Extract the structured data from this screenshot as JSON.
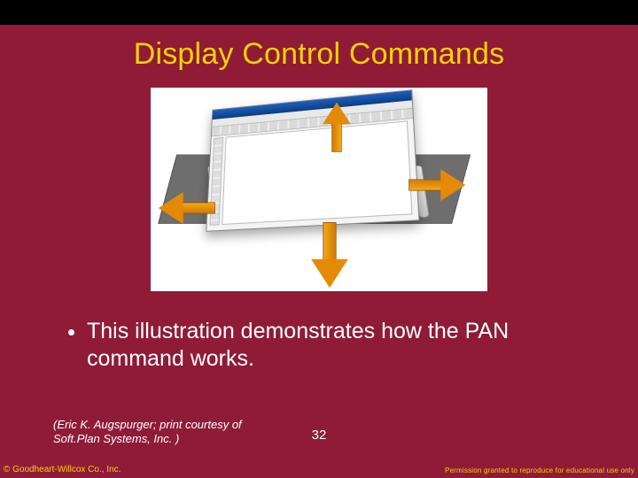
{
  "title": "Display Control Commands",
  "bullet_text": "This illustration demonstrates how the PAN command works.",
  "attribution": "(Eric K. Augspurger; print courtesy of Soft.Plan Systems, Inc. )",
  "slide_number": "32",
  "copyright": "© Goodheart-Willcox Co., Inc.",
  "permission": "Permission granted to reproduce for educational use only"
}
